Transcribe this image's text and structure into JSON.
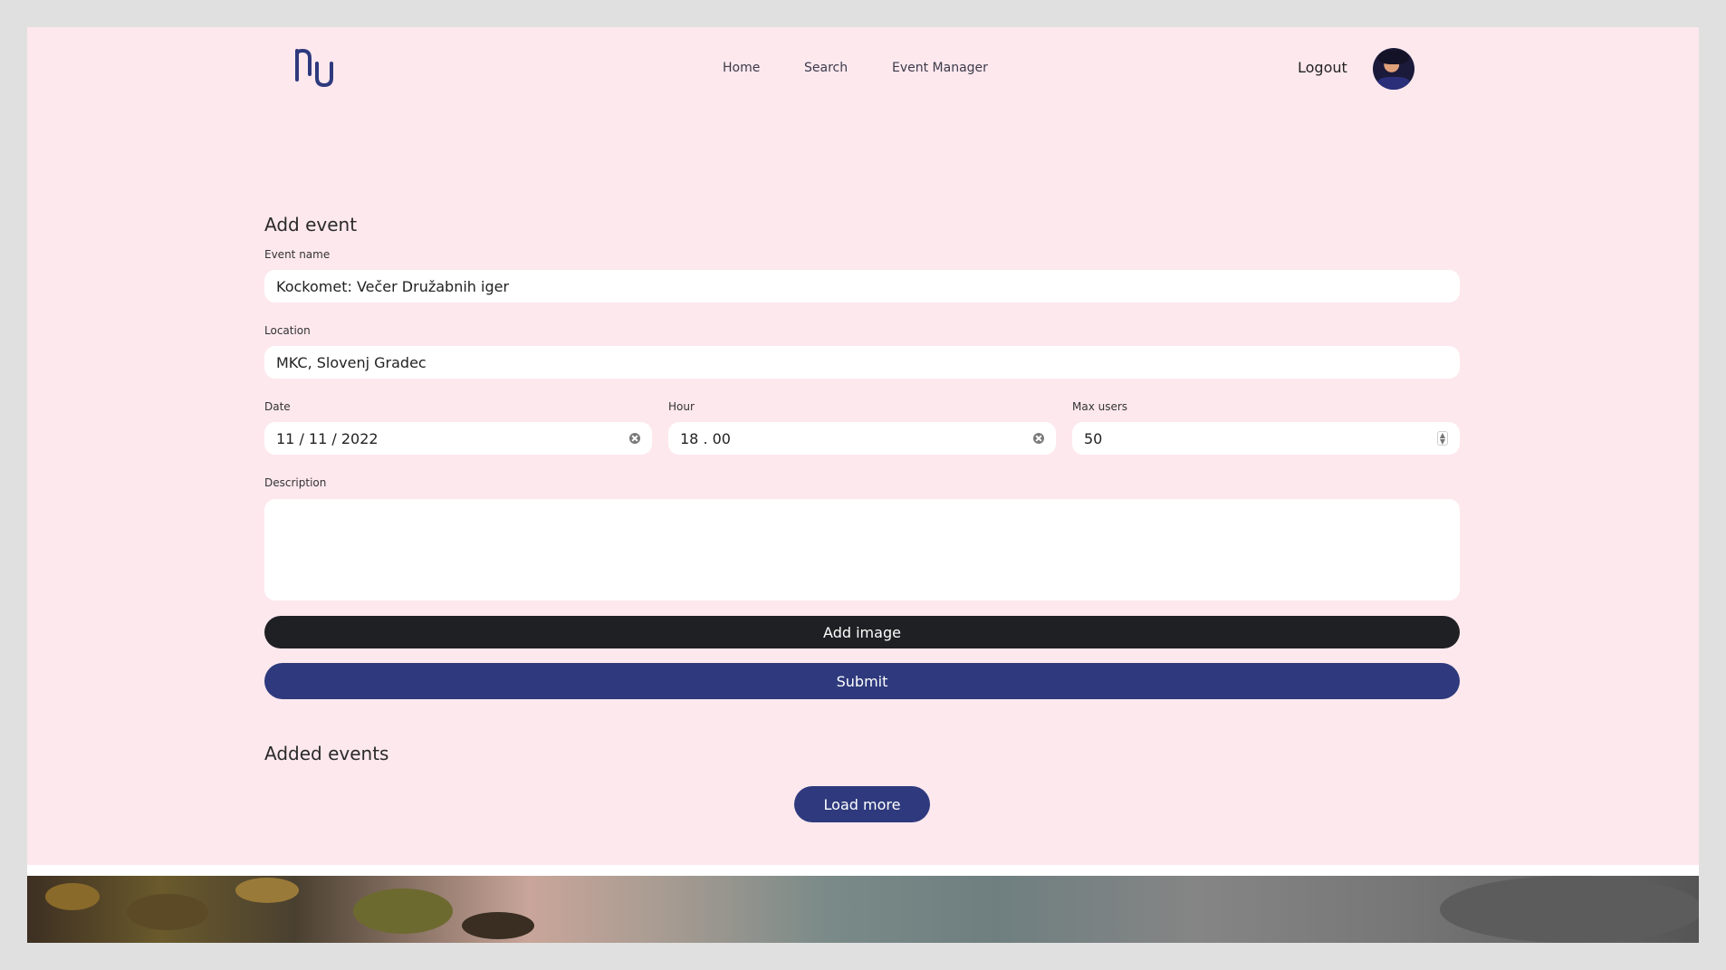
{
  "header": {
    "nav": [
      "Home",
      "Search",
      "Event Manager"
    ],
    "logout_label": "Logout"
  },
  "form": {
    "title": "Add event",
    "event_name": {
      "label": "Event name",
      "value": "Kockomet: Večer Družabnih iger"
    },
    "location": {
      "label": "Location",
      "value": "MKC, Slovenj Gradec"
    },
    "date": {
      "label": "Date",
      "value": "11 / 11 / 2022"
    },
    "hour": {
      "label": "Hour",
      "value": "18 . 00"
    },
    "max_users": {
      "label": "Max users",
      "value": "50"
    },
    "description": {
      "label": "Description",
      "value": ""
    },
    "add_image_label": "Add image",
    "submit_label": "Submit"
  },
  "added_events": {
    "title": "Added events",
    "load_more_label": "Load more"
  },
  "colors": {
    "page_bg": "#fde8ee",
    "primary": "#2e3a7d",
    "dark_button": "#1f2023"
  }
}
